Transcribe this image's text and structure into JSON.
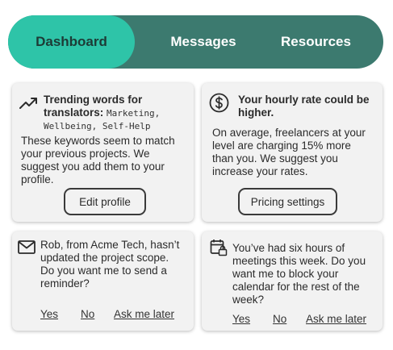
{
  "nav": {
    "tabs": [
      {
        "label": "Dashboard",
        "active": true
      },
      {
        "label": "Messages",
        "active": false
      },
      {
        "label": "Resources",
        "active": false
      }
    ]
  },
  "cards": {
    "trending": {
      "icon": "trending-up-icon",
      "title_line1": "Trending words for",
      "title_line2": "translators:",
      "keywords_line1": "Marketing,",
      "keywords_line2": "Wellbeing, Self-Help",
      "body_lines": [
        "These keywords seem to match",
        "your previous projects. We",
        "suggest you add them to your",
        "profile."
      ],
      "button": "Edit profile"
    },
    "rate": {
      "icon": "dollar-circle-icon",
      "title_lines": [
        "Your hourly rate could be",
        "higher."
      ],
      "body_lines": [
        "On average, freelancers at your",
        "level are charging 15% more",
        "than you. We suggest you",
        "increase your rates."
      ],
      "button": "Pricing settings"
    },
    "scope": {
      "icon": "mail-icon",
      "body_lines": [
        "Rob, from Acme Tech, hasn’t",
        "updated the project scope.",
        "Do you want me to send a",
        "reminder?"
      ],
      "actions": [
        "Yes",
        "No",
        "Ask me later"
      ]
    },
    "meetings": {
      "icon": "calendar-lock-icon",
      "body_lines": [
        "You’ve had six hours of",
        "meetings this week. Do you",
        "want me to block your",
        "calendar for the rest of the",
        "week?"
      ],
      "actions": [
        "Yes",
        "No",
        "Ask me later"
      ]
    }
  },
  "colors": {
    "nav_bg": "#3c7a6f",
    "nav_active": "#2ec4a8",
    "card_bg": "#f2f2f2"
  }
}
